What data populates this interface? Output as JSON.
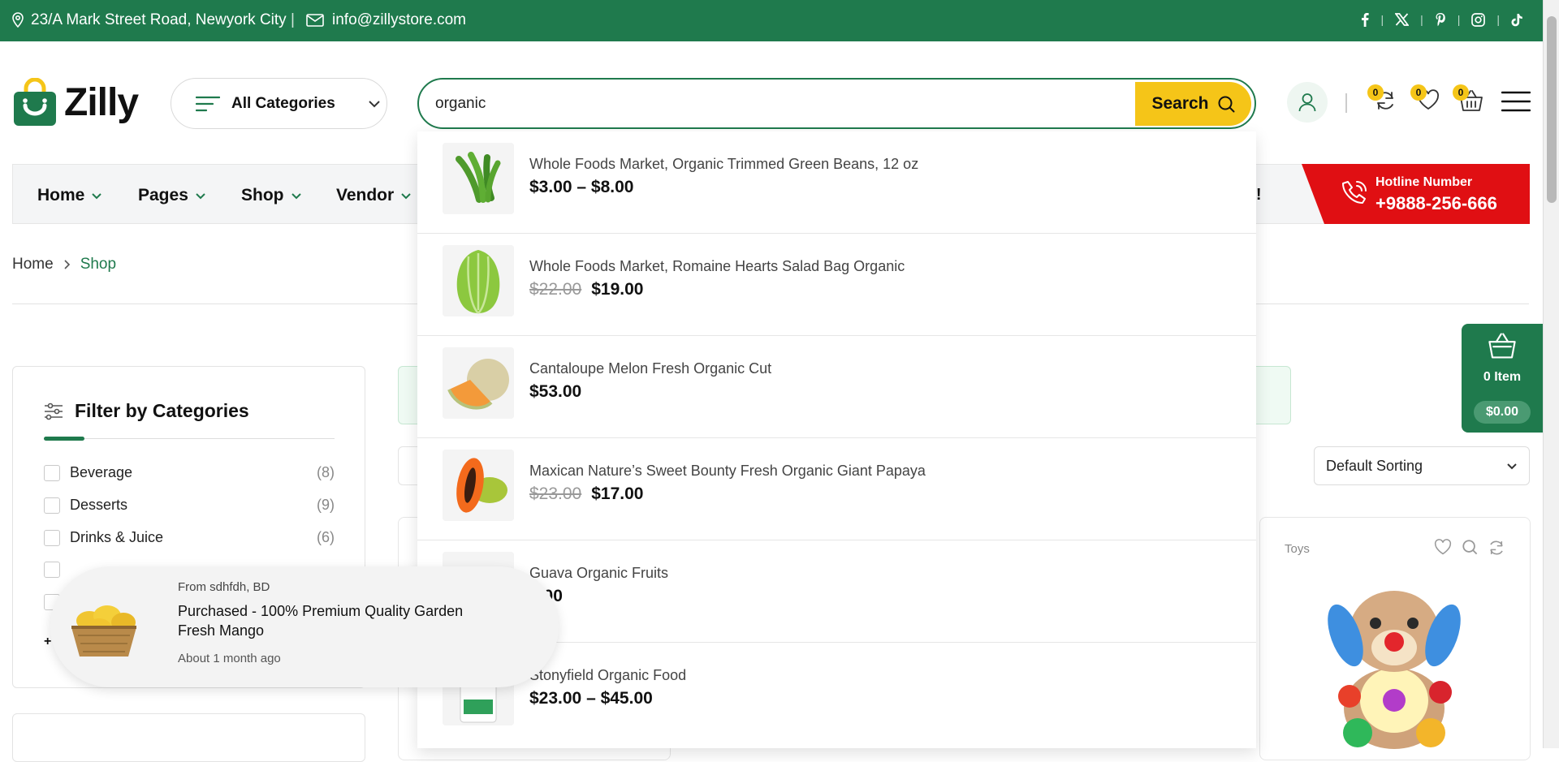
{
  "topbar": {
    "address": "23/A Mark Street Road, Newyork City",
    "separator": "|",
    "email": "info@zillystore.com",
    "social": [
      "facebook-icon",
      "x-icon",
      "pinterest-icon",
      "instagram-icon",
      "tiktok-icon"
    ]
  },
  "header": {
    "logo_text": "Zilly",
    "all_categories": "All Categories",
    "search_value": "organic",
    "search_button": "Search",
    "counts": {
      "compare": "0",
      "wishlist": "0",
      "cart": "0"
    }
  },
  "nav": {
    "items": [
      "Home",
      "Pages",
      "Shop",
      "Vendor"
    ],
    "tail_text": "nt!",
    "hotline_label": "Hotline Number",
    "hotline_number": "+9888-256-666"
  },
  "breadcrumb": {
    "home": "Home",
    "current": "Shop"
  },
  "sidebar": {
    "title": "Filter by Categories",
    "categories": [
      {
        "name": "Beverage",
        "count": "(8)"
      },
      {
        "name": "Desserts",
        "count": "(9)"
      },
      {
        "name": "Drinks & Juice",
        "count": "(6)"
      }
    ],
    "more": "+"
  },
  "toolbar": {
    "sorting": "Default Sorting",
    "partial_label": "s"
  },
  "products": {
    "toys_label": "Toys"
  },
  "mini_cart": {
    "items": "0 Item",
    "total": "$0.00"
  },
  "search_results": [
    {
      "name": "Whole Foods Market, Organic Trimmed Green Beans, 12 oz",
      "price": "$3.00 – $8.00",
      "old_price": ""
    },
    {
      "name": "Whole Foods Market, Romaine Hearts Salad Bag Organic",
      "price": "$19.00",
      "old_price": "$22.00"
    },
    {
      "name": "Cantaloupe Melon Fresh Organic Cut",
      "price": "$53.00",
      "old_price": ""
    },
    {
      "name": "Maxican Nature’s Sweet Bounty Fresh Organic Giant Papaya",
      "price": "$17.00",
      "old_price": "$23.00"
    },
    {
      "name": "Guava Organic Fruits",
      "price": "7.00",
      "old_price": ""
    },
    {
      "name": "Stonyfield Organic Food",
      "price": "$23.00 – $45.00",
      "old_price": ""
    }
  ],
  "toast": {
    "from": "From sdhfdh, BD",
    "message": "Purchased - 100% Premium Quality Garden Fresh Mango",
    "ago": "About 1 month ago"
  },
  "colors": {
    "brand_green": "#1f7a4d",
    "accent_yellow": "#f5c518",
    "hotline_red": "#e00f13"
  }
}
